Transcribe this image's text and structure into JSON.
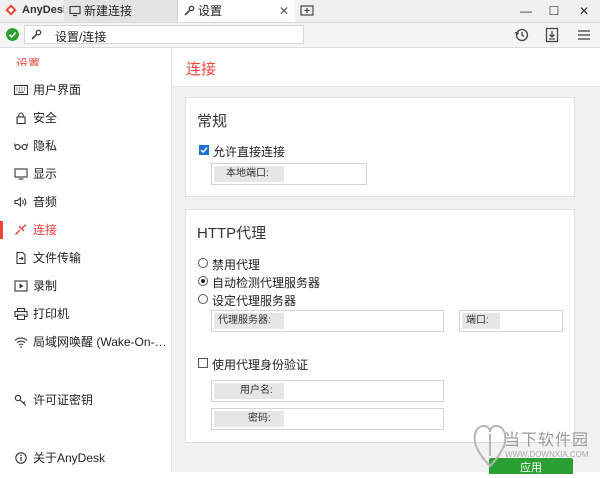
{
  "titlebar": {
    "app_name": "AnyDesk",
    "tabs": [
      {
        "label": "新建连接"
      },
      {
        "label": "设置",
        "close": "✕"
      }
    ],
    "minimize": "—",
    "maximize": "☐",
    "close": "✕"
  },
  "address": {
    "value": "设置/连接"
  },
  "sidebar": {
    "heading": "设置",
    "items": [
      {
        "label": "用户界面",
        "icon": "keyboard-icon"
      },
      {
        "label": "安全",
        "icon": "lock-icon"
      },
      {
        "label": "隐私",
        "icon": "glasses-icon"
      },
      {
        "label": "显示",
        "icon": "monitor-icon"
      },
      {
        "label": "音频",
        "icon": "speaker-icon"
      },
      {
        "label": "连接",
        "icon": "connection-icon",
        "active": true
      },
      {
        "label": "文件传输",
        "icon": "file-icon"
      },
      {
        "label": "录制",
        "icon": "record-icon"
      },
      {
        "label": "打印机",
        "icon": "printer-icon"
      },
      {
        "label": "局域网唤醒 (Wake-On-LAN)",
        "icon": "wifi-icon"
      },
      {
        "label": "许可证密钥",
        "icon": "key-icon"
      },
      {
        "label": "关于AnyDesk",
        "icon": "info-icon"
      }
    ]
  },
  "main": {
    "title": "连接",
    "general": {
      "title": "常规",
      "allow_direct": "允许直接连接",
      "allow_direct_checked": true,
      "local_port_label": "本地端口:",
      "local_port_value": ""
    },
    "proxy": {
      "title": "HTTP代理",
      "options": [
        {
          "label": "禁用代理",
          "selected": false
        },
        {
          "label": "自动检测代理服务器",
          "selected": true
        },
        {
          "label": "设定代理服务器",
          "selected": false
        }
      ],
      "server_label": "代理服务器:",
      "port_label": "端口:",
      "auth_label": "使用代理身份验证",
      "auth_checked": false,
      "username_label": "用户名:",
      "password_label": "密码:"
    },
    "apply_label": "应用"
  },
  "watermark": {
    "text": "当下软件园",
    "url": "WWW.DOWNXIA.COM"
  },
  "colors": {
    "accent": "#ef443b",
    "status_ok": "#2aa033",
    "checkbox": "#1a6fd1"
  }
}
